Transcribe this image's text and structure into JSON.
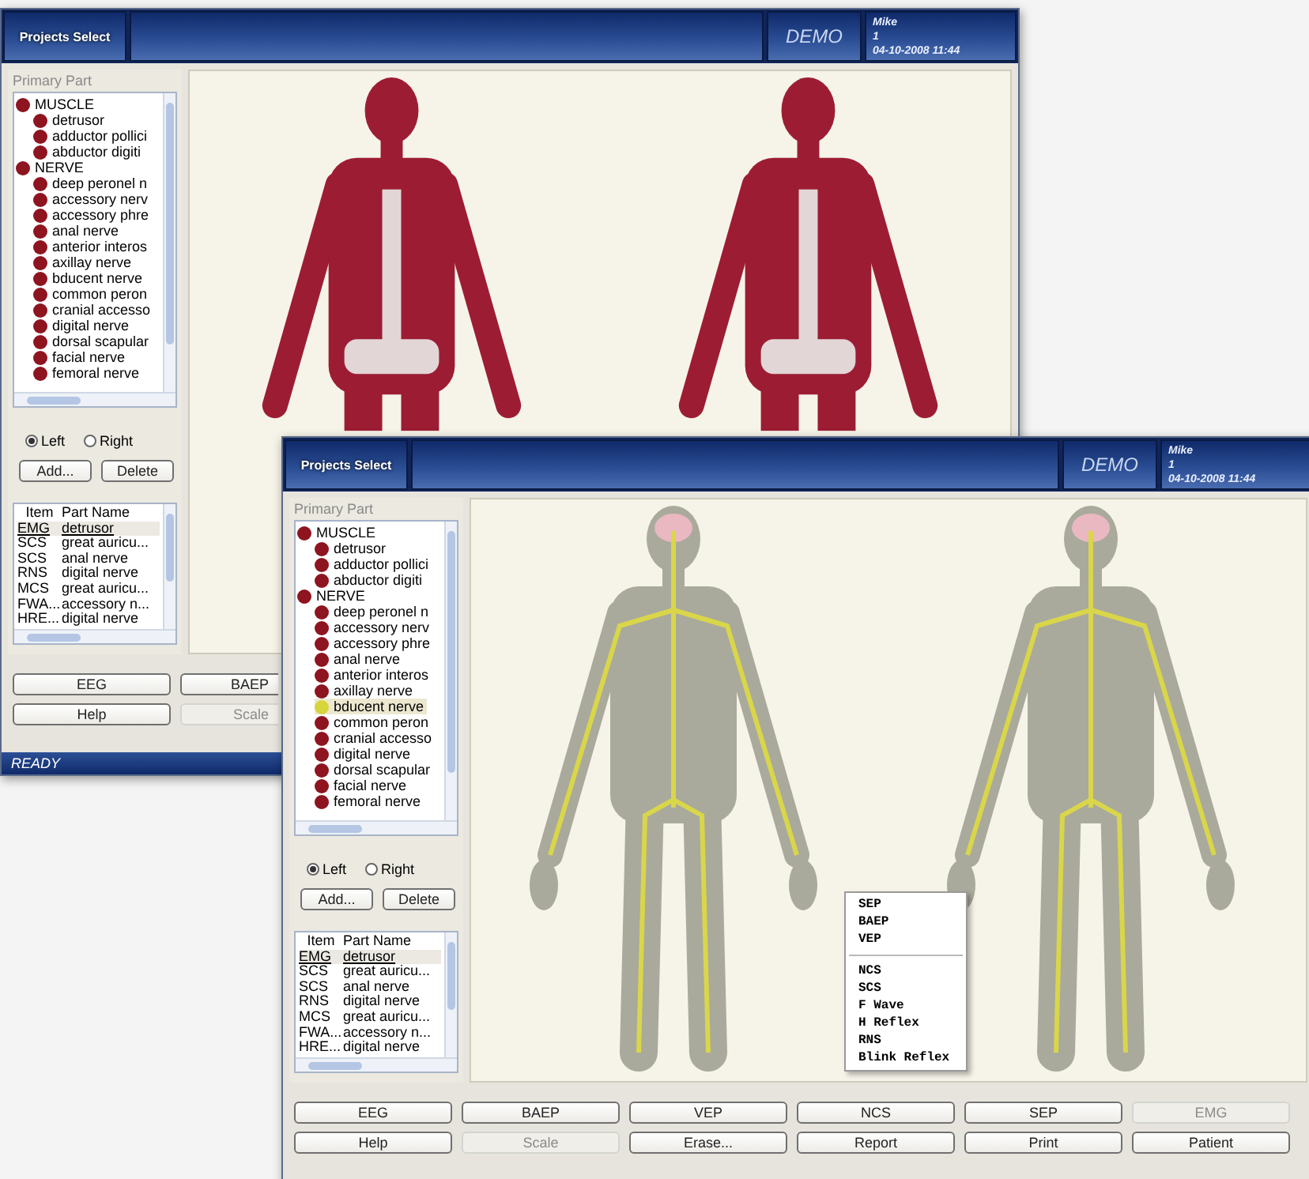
{
  "windows": [
    {
      "kind": "back",
      "header": {
        "tab": "Projects Select",
        "mode": "DEMO",
        "user": "Mike",
        "user_id": "1",
        "datetime": "04-10-2008 11:44"
      },
      "panel": {
        "label": "Primary Part",
        "tree": [
          {
            "label": "MUSCLE",
            "selected": false,
            "children": [
              {
                "label": "detrusor",
                "selected": false
              },
              {
                "label": "adductor pollici",
                "selected": false
              },
              {
                "label": "abductor digiti",
                "selected": false
              }
            ]
          },
          {
            "label": "NERVE",
            "selected": false,
            "children": [
              {
                "label": "deep peronel n",
                "selected": false
              },
              {
                "label": "accessory nerv",
                "selected": false
              },
              {
                "label": "accessory phre",
                "selected": false
              },
              {
                "label": "anal nerve",
                "selected": false
              },
              {
                "label": "anterior interos",
                "selected": false
              },
              {
                "label": "axillay nerve",
                "selected": false
              },
              {
                "label": "bducent nerve",
                "selected": false
              },
              {
                "label": "common peron",
                "selected": false
              },
              {
                "label": "cranial accesso",
                "selected": false
              },
              {
                "label": "digital nerve",
                "selected": false
              },
              {
                "label": "dorsal scapular",
                "selected": false
              },
              {
                "label": "facial nerve",
                "selected": false
              },
              {
                "label": "femoral nerve",
                "selected": false
              }
            ]
          }
        ],
        "sides": [
          {
            "label": "Left",
            "selected": true
          },
          {
            "label": "Right",
            "selected": false
          }
        ],
        "actions": [
          "Add...",
          "Delete"
        ],
        "table": {
          "columns": [
            "Item",
            "Part Name"
          ],
          "rows": [
            {
              "item": "EMG",
              "part_name": "detrusor",
              "selected": true
            },
            {
              "item": "SCS",
              "part_name": "great auricu...",
              "selected": false
            },
            {
              "item": "SCS",
              "part_name": "anal nerve",
              "selected": false
            },
            {
              "item": "RNS",
              "part_name": "digital nerve",
              "selected": false
            },
            {
              "item": "MCS",
              "part_name": "great auricu...",
              "selected": false
            },
            {
              "item": "FWA...",
              "part_name": "accessory n...",
              "selected": false
            },
            {
              "item": "HRE...",
              "part_name": "digital nerve",
              "selected": false
            }
          ]
        }
      },
      "diagram": {
        "kind": "muscle"
      },
      "buttons": [
        [
          {
            "label": "EEG",
            "disabled": false
          },
          {
            "label": "BAEP",
            "disabled": false
          }
        ],
        [
          {
            "label": "Help",
            "disabled": false
          },
          {
            "label": "Scale",
            "disabled": true
          }
        ]
      ],
      "status_bar": "READY"
    },
    {
      "kind": "front",
      "header": {
        "tab": "Projects Select",
        "mode": "DEMO",
        "user": "Mike",
        "user_id": "1",
        "datetime": "04-10-2008 11:44"
      },
      "panel": {
        "label": "Primary Part",
        "tree": [
          {
            "label": "MUSCLE",
            "selected": false,
            "children": [
              {
                "label": "detrusor",
                "selected": false
              },
              {
                "label": "adductor pollici",
                "selected": false
              },
              {
                "label": "abductor digiti",
                "selected": false
              }
            ]
          },
          {
            "label": "NERVE",
            "selected": false,
            "children": [
              {
                "label": "deep peronel n",
                "selected": false
              },
              {
                "label": "accessory nerv",
                "selected": false
              },
              {
                "label": "accessory phre",
                "selected": false
              },
              {
                "label": "anal nerve",
                "selected": false
              },
              {
                "label": "anterior interos",
                "selected": false
              },
              {
                "label": "axillay nerve",
                "selected": false
              },
              {
                "label": "bducent nerve",
                "selected": true
              },
              {
                "label": "common peron",
                "selected": false
              },
              {
                "label": "cranial accesso",
                "selected": false
              },
              {
                "label": "digital nerve",
                "selected": false
              },
              {
                "label": "dorsal scapular",
                "selected": false
              },
              {
                "label": "facial nerve",
                "selected": false
              },
              {
                "label": "femoral nerve",
                "selected": false
              }
            ]
          }
        ],
        "sides": [
          {
            "label": "Left",
            "selected": true
          },
          {
            "label": "Right",
            "selected": false
          }
        ],
        "actions": [
          "Add...",
          "Delete"
        ],
        "table": {
          "columns": [
            "Item",
            "Part Name"
          ],
          "rows": [
            {
              "item": "EMG",
              "part_name": "detrusor",
              "selected": true
            },
            {
              "item": "SCS",
              "part_name": "great auricu...",
              "selected": false
            },
            {
              "item": "SCS",
              "part_name": "anal nerve",
              "selected": false
            },
            {
              "item": "RNS",
              "part_name": "digital nerve",
              "selected": false
            },
            {
              "item": "MCS",
              "part_name": "great auricu...",
              "selected": false
            },
            {
              "item": "FWA...",
              "part_name": "accessory n...",
              "selected": false
            },
            {
              "item": "HRE...",
              "part_name": "digital nerve",
              "selected": false
            }
          ]
        }
      },
      "diagram": {
        "kind": "nerve"
      },
      "context_menu": [
        {
          "kind": "item",
          "label": "SEP"
        },
        {
          "kind": "item",
          "label": "BAEP"
        },
        {
          "kind": "item",
          "label": "VEP"
        },
        {
          "kind": "separator"
        },
        {
          "kind": "item",
          "label": "NCS"
        },
        {
          "kind": "item",
          "label": "SCS"
        },
        {
          "kind": "item",
          "label": "F Wave"
        },
        {
          "kind": "item",
          "label": "H Reflex"
        },
        {
          "kind": "item",
          "label": "RNS"
        },
        {
          "kind": "item",
          "label": "Blink Reflex"
        }
      ],
      "buttons": [
        [
          {
            "label": "EEG",
            "disabled": false
          },
          {
            "label": "BAEP",
            "disabled": false
          },
          {
            "label": "VEP",
            "disabled": false
          },
          {
            "label": "NCS",
            "disabled": false
          },
          {
            "label": "SEP",
            "disabled": false
          },
          {
            "label": "EMG",
            "disabled": true
          }
        ],
        [
          {
            "label": "Help",
            "disabled": false
          },
          {
            "label": "Scale",
            "disabled": true
          },
          {
            "label": "Erase...",
            "disabled": false
          },
          {
            "label": "Report",
            "disabled": false
          },
          {
            "label": "Print",
            "disabled": false
          },
          {
            "label": "Patient",
            "disabled": false
          }
        ]
      ]
    }
  ]
}
